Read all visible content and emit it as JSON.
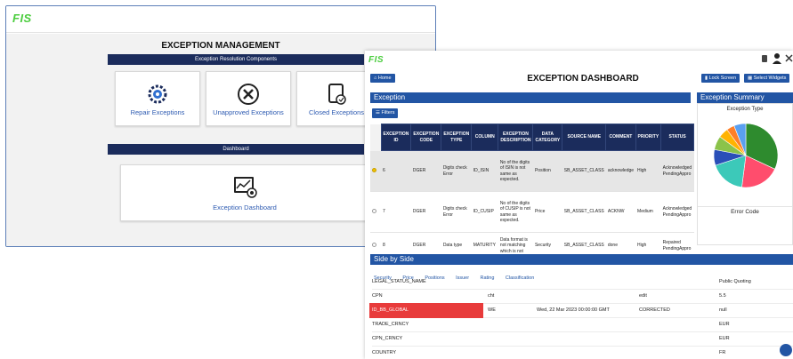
{
  "win1": {
    "logo": "FIS",
    "title": "EXCEPTION MANAGEMENT",
    "resolution_header": "Exception Resolution Components",
    "cards": [
      {
        "label": "Repair Exceptions",
        "icon": "gears-icon"
      },
      {
        "label": "Unapproved Exceptions",
        "icon": "x-circle-icon"
      },
      {
        "label": "Closed Exceptions",
        "icon": "closed-file-icon"
      }
    ],
    "dashboard_header": "Dashboard",
    "dashboard_card": {
      "label": "Exception Dashboard",
      "icon": "dashboard-icon"
    }
  },
  "win2": {
    "logo": "FIS",
    "home_label": "Home",
    "title": "EXCEPTION DASHBOARD",
    "lock_label": "Lock Screen",
    "widgets_label": "Select Widgets",
    "exception_header": "Exception",
    "filters_label": "Filters",
    "summary_header": "Exception Summary",
    "summary_subtitle": "Exception Type",
    "summary_footer": "Error Code",
    "columns": [
      "EXCEPTION ID",
      "EXCEPTION CODE",
      "EXCEPTION TYPE",
      "COLUMN",
      "EXCEPTION DESCRIPTION",
      "DATA CATEGORY",
      "SOURCE NAME",
      "COMMENT",
      "PRIORITY",
      "STATUS"
    ],
    "rows": [
      {
        "id": "6",
        "code": "DGER",
        "type": "Digits check Error",
        "column": "ID_ISIN",
        "desc": "No of the digits of ISIN is not same as expected.",
        "category": "Position",
        "source": "SB_ASSET_CLASS",
        "comment": "acknowledge",
        "priority": "High",
        "status": "Acknowledged PendingAppro"
      },
      {
        "id": "7",
        "code": "DGER",
        "type": "Digits check Error",
        "column": "ID_CUSIP",
        "desc": "No of the digits of CUSIP is not same as expected.",
        "category": "Price",
        "source": "SB_ASSET_CLASS",
        "comment": "ACKNW",
        "priority": "Medium",
        "status": "Acknowledged PendingAppro"
      },
      {
        "id": "8",
        "code": "DGER",
        "type": "Data type",
        "column": "MATURITY",
        "desc": "Data format is not matching which is not",
        "category": "Security",
        "source": "SB_ASSET_CLASS",
        "comment": "done",
        "priority": "High",
        "status": "Repaired PendingAppro"
      }
    ],
    "side_header": "Side by Side",
    "side_tabs": [
      "Security",
      "Price",
      "Positions",
      "Issuer",
      "Rating",
      "Classification"
    ],
    "side_rows": [
      {
        "c0": "LEGAL_STATUS_NAME",
        "c1": "",
        "c2": "",
        "c3": "",
        "c4": "Public Quoting",
        "hl": false
      },
      {
        "c0": "CPN",
        "c1": "cht",
        "c2": "",
        "c3": "edit",
        "c4": "5.5",
        "hl": false
      },
      {
        "c0": "ID_BB_GLOBAL",
        "c1": "WE",
        "c2": "Wed, 22 Mar 2023 00:00:00 GMT",
        "c3": "CORRECTED",
        "c4": "null",
        "hl": true
      },
      {
        "c0": "TRADE_CRNCY",
        "c1": "",
        "c2": "",
        "c3": "",
        "c4": "EUR",
        "hl": false
      },
      {
        "c0": "CPN_CRNCY",
        "c1": "",
        "c2": "",
        "c3": "",
        "c4": "EUR",
        "hl": false
      },
      {
        "c0": "COUNTRY",
        "c1": "",
        "c2": "",
        "c3": "",
        "c4": "FR",
        "hl": false
      }
    ],
    "pie": [
      {
        "value": 32,
        "color": "#2e8b2e"
      },
      {
        "value": 20,
        "color": "#ff4d6d"
      },
      {
        "value": 18,
        "color": "#3cc9b9"
      },
      {
        "value": 8,
        "color": "#2a4fb8"
      },
      {
        "value": 7,
        "color": "#8bc34a"
      },
      {
        "value": 5,
        "color": "#ffb300"
      },
      {
        "value": 4,
        "color": "#ff7f27"
      },
      {
        "value": 6,
        "color": "#5aa0f0"
      }
    ]
  }
}
